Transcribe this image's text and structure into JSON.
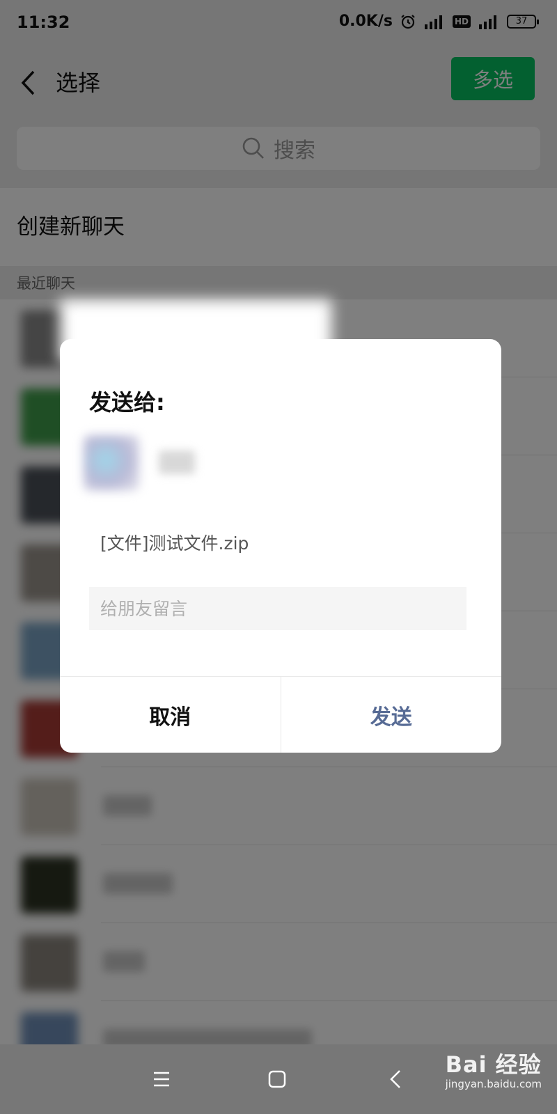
{
  "status_bar": {
    "time": "11:32",
    "net_speed": "0.0K/s",
    "net1": "4G",
    "hd": "HD",
    "net2": "4G",
    "battery": "37"
  },
  "header": {
    "title": "选择",
    "multi_select": "多选"
  },
  "search": {
    "placeholder": "搜索"
  },
  "list": {
    "create_new_chat": "创建新聊天",
    "section_label": "最近聊天"
  },
  "dialog": {
    "title": "发送给:",
    "file": "[文件]测试文件.zip",
    "message_placeholder": "给朋友留言",
    "cancel": "取消",
    "send": "发送"
  },
  "watermark": {
    "main": "Bai  经验",
    "sub": "jingyan.baidu.com"
  },
  "colors": {
    "accent_green": "#07c160",
    "send_blue": "#576b95"
  }
}
